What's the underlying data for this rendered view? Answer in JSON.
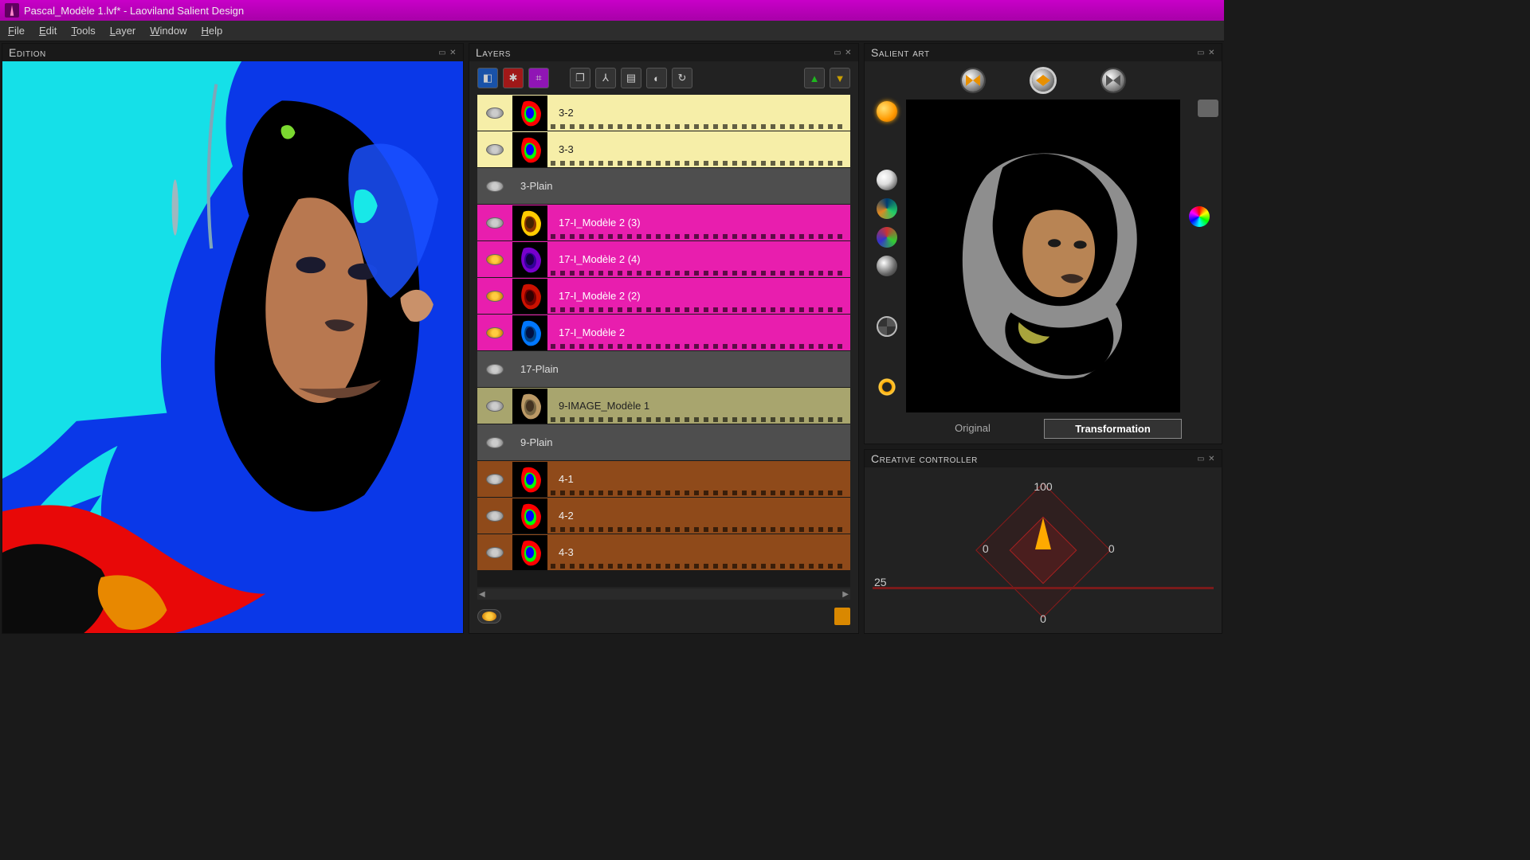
{
  "title": "Pascal_Modèle 1.lvf* - Laoviland Salient Design",
  "menu": {
    "file": "File",
    "edit": "Edit",
    "tools": "Tools",
    "layer": "Layer",
    "window": "Window",
    "help": "Help"
  },
  "panels": {
    "edition": "Edition",
    "layers": "Layers",
    "salient": "Salient art",
    "creative": "Creative controller"
  },
  "layers": [
    {
      "name": "3-2",
      "bg": "#f6eea8",
      "fg": "#222",
      "thumb": "rainbow",
      "eye": "off",
      "film": true
    },
    {
      "name": "3-3",
      "bg": "#f6eea8",
      "fg": "#222",
      "thumb": "rainbow",
      "eye": "off",
      "film": true
    },
    {
      "name": "3-Plain",
      "bg": "#4e4e4e",
      "fg": "#ddd",
      "thumb": "none",
      "eye": "off",
      "film": false
    },
    {
      "name": "17-I_Modèle 2 (3)",
      "bg": "#e81eae",
      "fg": "#fff",
      "thumb": "yellow",
      "eye": "off",
      "film": true
    },
    {
      "name": "17-I_Modèle 2 (4)",
      "bg": "#e81eae",
      "fg": "#fff",
      "thumb": "purple",
      "eye": "on",
      "film": true
    },
    {
      "name": "17-I_Modèle 2 (2)",
      "bg": "#e81eae",
      "fg": "#fff",
      "thumb": "red",
      "eye": "on",
      "film": true
    },
    {
      "name": "17-I_Modèle 2",
      "bg": "#e81eae",
      "fg": "#fff",
      "thumb": "blue",
      "eye": "on",
      "film": true
    },
    {
      "name": "17-Plain",
      "bg": "#4e4e4e",
      "fg": "#ddd",
      "thumb": "none",
      "eye": "off",
      "film": false
    },
    {
      "name": "9-IMAGE_Modèle 1",
      "bg": "#a8a56e",
      "fg": "#222",
      "thumb": "sepia",
      "eye": "off",
      "film": true
    },
    {
      "name": "9-Plain",
      "bg": "#4e4e4e",
      "fg": "#ddd",
      "thumb": "none",
      "eye": "off",
      "film": false
    },
    {
      "name": "4-1",
      "bg": "#8f4a1a",
      "fg": "#eee",
      "thumb": "rainbow",
      "eye": "off",
      "film": true
    },
    {
      "name": "4-2",
      "bg": "#8f4a1a",
      "fg": "#eee",
      "thumb": "rainbow",
      "eye": "off",
      "film": true
    },
    {
      "name": "4-3",
      "bg": "#8f4a1a",
      "fg": "#eee",
      "thumb": "rainbow",
      "eye": "off",
      "film": true
    }
  ],
  "salient": {
    "tabs": {
      "original": "Original",
      "transformation": "Transformation",
      "active": "transformation"
    }
  },
  "creative": {
    "top": "100",
    "left": "0",
    "right": "0",
    "bottom": "0",
    "slider": "25"
  }
}
